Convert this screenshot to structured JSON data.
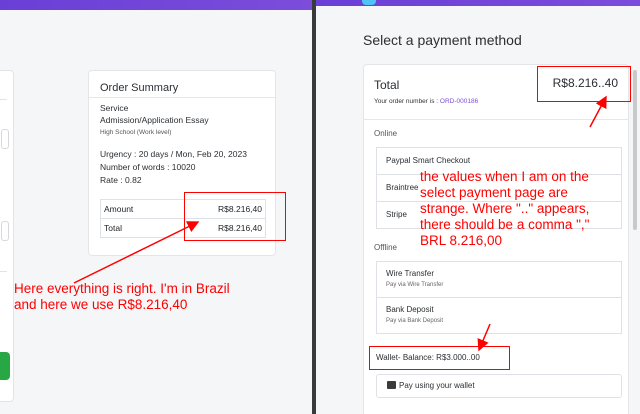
{
  "left_panel": {
    "order_summary": {
      "title": "Order Summary",
      "service_label": "Service",
      "service_name": "Admission/Application Essay",
      "level": "High School (Work level)",
      "urgency": "Urgency : 20 days / Mon, Feb 20, 2023",
      "words": "Number of words : 10020",
      "rate": "Rate : 0.82",
      "rows": [
        {
          "label": "Amount",
          "value": "R$8.216,40"
        },
        {
          "label": "Total",
          "value": "R$8.216,40"
        }
      ]
    }
  },
  "right_panel": {
    "heading": "Select a payment method",
    "total_label": "Total",
    "total_value": "R$8.216..40",
    "order_number_label": "Your order number is :",
    "order_number": "ORD-000186",
    "online_label": "Online",
    "online_options": [
      "Paypal Smart Checkout",
      "Braintree",
      "Stripe"
    ],
    "offline_label": "Offline",
    "offline_options": [
      {
        "name": "Wire Transfer",
        "sub": "Pay via Wire Transfer"
      },
      {
        "name": "Bank Deposit",
        "sub": "Pay via Bank Deposit"
      }
    ],
    "wallet_balance": "Wallet- Balance: R$3.000..00",
    "wallet_button": "Pay using your wallet"
  },
  "annotations": {
    "left_note": [
      "Here everything is right. I'm in Brazil",
      "and here we use R$8.216,40"
    ],
    "right_note": [
      "the values when I am on the",
      "select payment page are",
      "strange. Where \"..\" appears,",
      "there should be a comma \",\"",
      "BRL 8.216,00"
    ],
    "color": "#ff0000"
  },
  "colors": {
    "accent": "#7b4fd6",
    "wallet_icon": "#3b3b3b",
    "green_button": "#28a745"
  }
}
